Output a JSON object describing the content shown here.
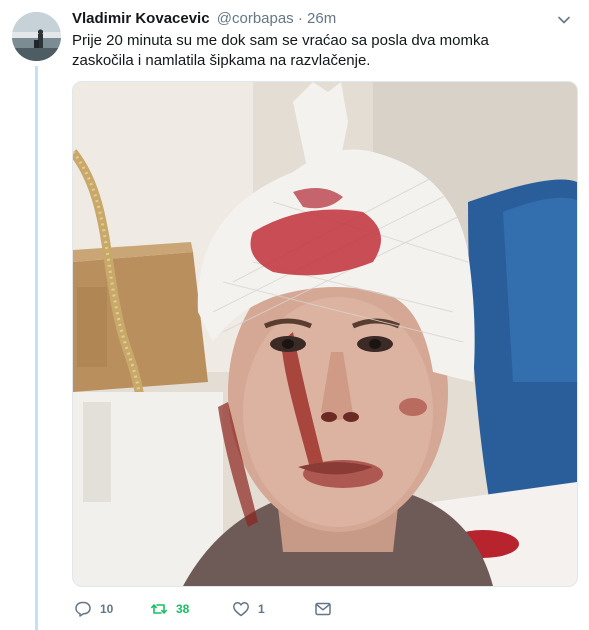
{
  "tweet": {
    "author_name": "Vladimir Kovacevic",
    "author_handle": "@corbapas",
    "separator": "·",
    "timestamp": "26m",
    "text": "Prije 20 minuta su me dok sam se vraćao sa posla dva momka zaskočila i namlatila šipkama na razvlačenje.",
    "media_icon": "photo",
    "more_icon": "chevron-down-icon"
  },
  "actions": {
    "reply": {
      "icon": "reply-icon",
      "count": "10"
    },
    "retweet": {
      "icon": "retweet-icon",
      "count": "38",
      "color": "#17bf63"
    },
    "like": {
      "icon": "heart-icon",
      "count": "1"
    },
    "dm": {
      "icon": "envelope-icon"
    }
  },
  "colors": {
    "text": "#14171a",
    "muted": "#657786",
    "thread_line": "#c4e0f4",
    "retweet_active": "#17bf63"
  }
}
